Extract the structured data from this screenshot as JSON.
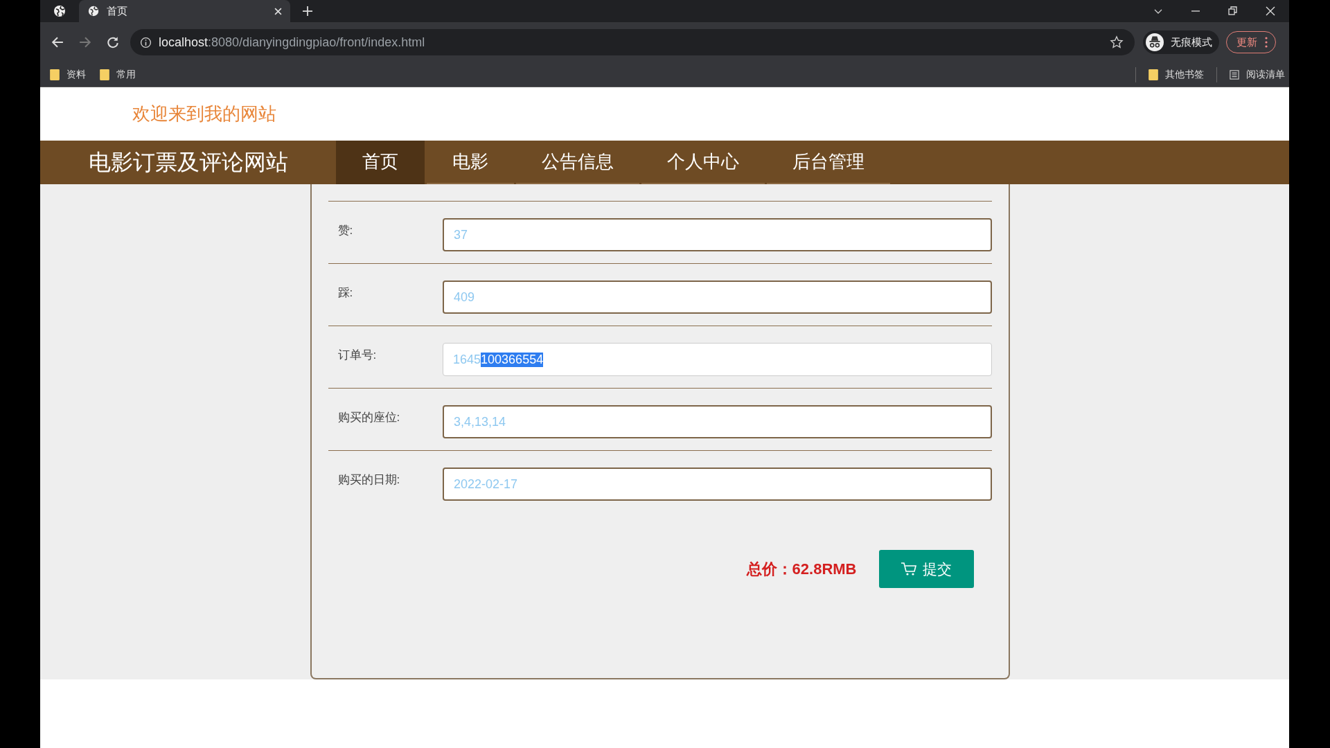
{
  "browser": {
    "tab_title": "首页",
    "url_host": "localhost",
    "url_rest": ":8080/dianyingdingpiao/front/index.html",
    "incognito_label": "无痕模式",
    "update_label": "更新",
    "bookmarks": [
      "资料",
      "常用"
    ],
    "other_bookmarks": "其他书签",
    "reading_list": "阅读清单"
  },
  "header": {
    "welcome": "欢迎来到我的网站"
  },
  "nav": {
    "brand": "电影订票及评论网站",
    "items": [
      {
        "label": "首页",
        "selected": true
      },
      {
        "label": "电影",
        "selected": false
      },
      {
        "label": "公告信息",
        "selected": false
      },
      {
        "label": "个人中心",
        "selected": false
      },
      {
        "label": "后台管理",
        "selected": false
      }
    ]
  },
  "form": {
    "fields": [
      {
        "label": "赞:",
        "value": "37"
      },
      {
        "label": "踩:",
        "value": "409"
      },
      {
        "label": "订单号:",
        "value": "1645",
        "selected_text": "100366554"
      },
      {
        "label": "购买的座位:",
        "value": "3,4,13,14"
      },
      {
        "label": "购买的日期:",
        "value": "2022-02-17"
      }
    ],
    "total": "总价：62.8RMB",
    "submit": "提交"
  }
}
